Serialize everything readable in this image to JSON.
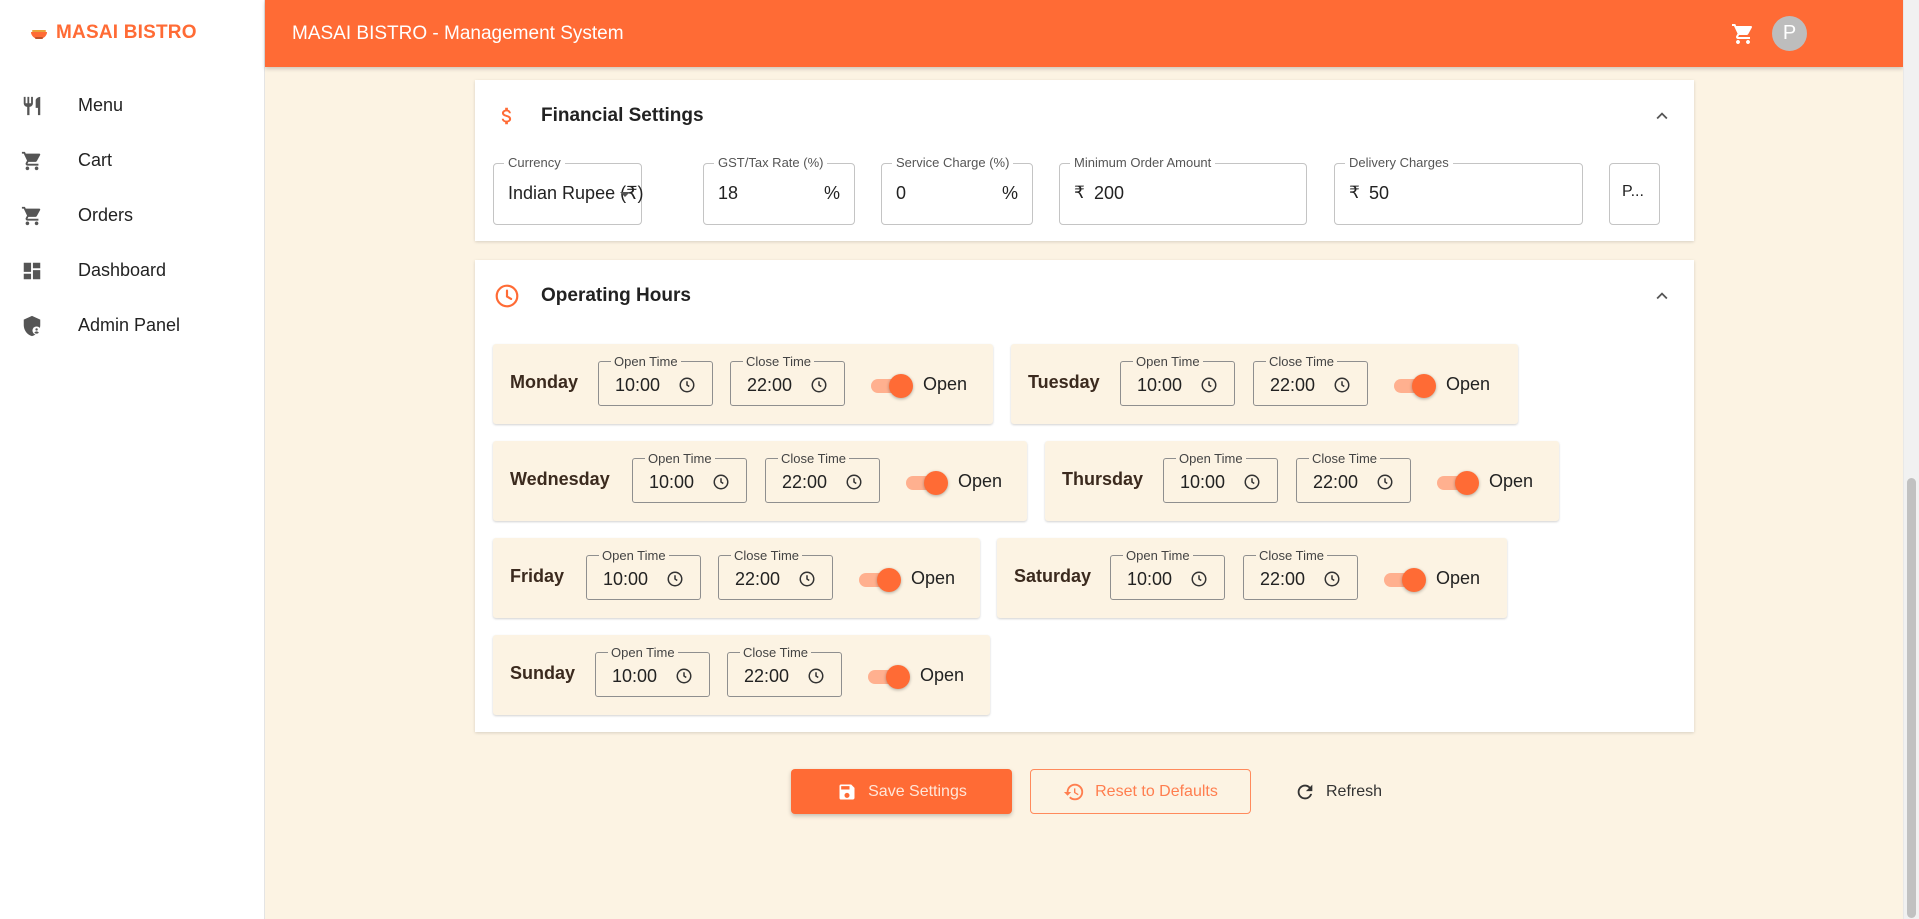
{
  "sidebar": {
    "brand": "MASAI BISTRO",
    "items": [
      {
        "label": "Menu",
        "icon": "fork-knife-icon"
      },
      {
        "label": "Cart",
        "icon": "cart-icon"
      },
      {
        "label": "Orders",
        "icon": "cart-icon"
      },
      {
        "label": "Dashboard",
        "icon": "dashboard-icon"
      },
      {
        "label": "Admin Panel",
        "icon": "admin-shield-icon"
      }
    ]
  },
  "header": {
    "title": "MASAI BISTRO - Management System",
    "avatar_initial": "P"
  },
  "financial": {
    "title": "Financial Settings",
    "currency": {
      "label": "Currency",
      "value": "Indian Rupee (₹)"
    },
    "gst": {
      "label": "GST/Tax Rate (%)",
      "value": "18",
      "suffix": "%"
    },
    "service": {
      "label": "Service Charge (%)",
      "value": "0",
      "suffix": "%"
    },
    "min_order": {
      "label": "Minimum Order Amount",
      "prefix": "₹",
      "value": "200"
    },
    "delivery": {
      "label": "Delivery Charges",
      "prefix": "₹",
      "value": "50"
    },
    "truncated_value": "P..."
  },
  "hours": {
    "title": "Operating Hours",
    "open_time_label": "Open Time",
    "close_time_label": "Close Time",
    "days": [
      {
        "name": "Monday",
        "open": "10:00",
        "close": "22:00",
        "status": "Open",
        "enabled": true
      },
      {
        "name": "Tuesday",
        "open": "10:00",
        "close": "22:00",
        "status": "Open",
        "enabled": true
      },
      {
        "name": "Wednesday",
        "open": "10:00",
        "close": "22:00",
        "status": "Open",
        "enabled": true
      },
      {
        "name": "Thursday",
        "open": "10:00",
        "close": "22:00",
        "status": "Open",
        "enabled": true
      },
      {
        "name": "Friday",
        "open": "10:00",
        "close": "22:00",
        "status": "Open",
        "enabled": true
      },
      {
        "name": "Saturday",
        "open": "10:00",
        "close": "22:00",
        "status": "Open",
        "enabled": true
      },
      {
        "name": "Sunday",
        "open": "10:00",
        "close": "22:00",
        "status": "Open",
        "enabled": true
      }
    ]
  },
  "actions": {
    "save": "Save Settings",
    "reset": "Reset to Defaults",
    "refresh": "Refresh"
  },
  "colors": {
    "accent": "#ff6b35",
    "background": "#fcf3e3"
  }
}
